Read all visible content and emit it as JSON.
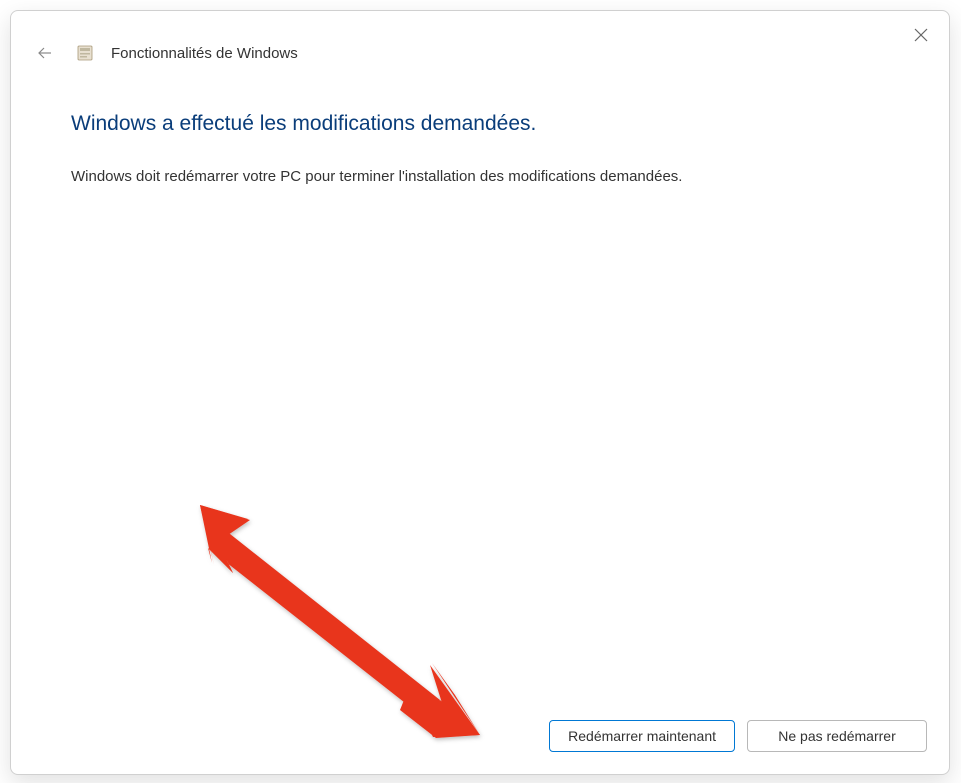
{
  "dialog": {
    "title": "Fonctionnalités de Windows",
    "heading": "Windows a effectué les modifications demandées.",
    "description": "Windows doit redémarrer votre PC pour terminer l'installation des modifications demandées."
  },
  "buttons": {
    "restart_now": "Redémarrer maintenant",
    "dont_restart": "Ne pas redémarrer"
  }
}
